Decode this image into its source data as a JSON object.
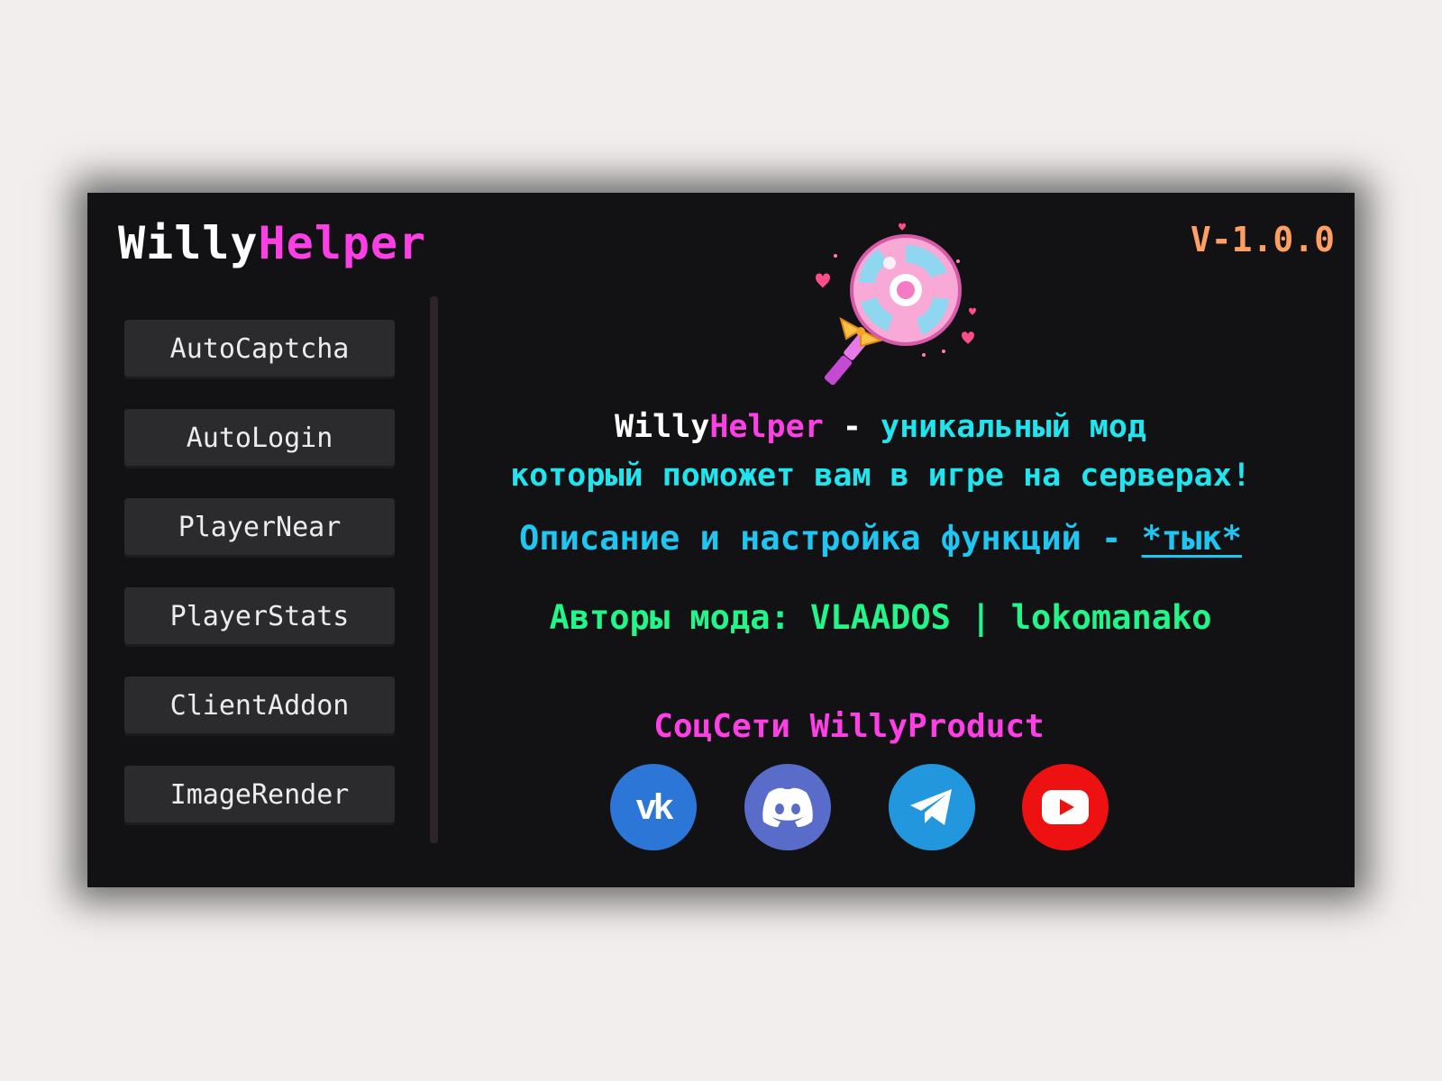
{
  "app": {
    "logo_part1": "Willy",
    "logo_part2": "Helper",
    "version": "V-1.0.0"
  },
  "menu": {
    "items": [
      {
        "label": "AutoCaptcha"
      },
      {
        "label": "AutoLogin"
      },
      {
        "label": "PlayerNear"
      },
      {
        "label": "PlayerStats"
      },
      {
        "label": "ClientAddon"
      },
      {
        "label": "ImageRender"
      }
    ]
  },
  "description": {
    "name_part1": "Willy",
    "name_part2": "Helper",
    "dash": " - ",
    "line1_text": "уникальный мод",
    "line2_text": "который поможет вам в игре на серверах!",
    "line3_text": "Описание и настройка функций - ",
    "line3_link": "*тык*"
  },
  "authors": {
    "text": "Авторы мода: VLAADOS | lokomanako"
  },
  "social": {
    "title": "СоцСети WillyProduct",
    "vk_label": "vk",
    "icons": [
      "vk-icon",
      "discord-icon",
      "telegram-icon",
      "youtube-icon"
    ]
  },
  "colors": {
    "background": "#121214",
    "accent_pink": "#ff3fe6",
    "accent_cyan": "#20e4ee",
    "accent_green": "#22f58a",
    "version_orange": "#ff9f62"
  }
}
